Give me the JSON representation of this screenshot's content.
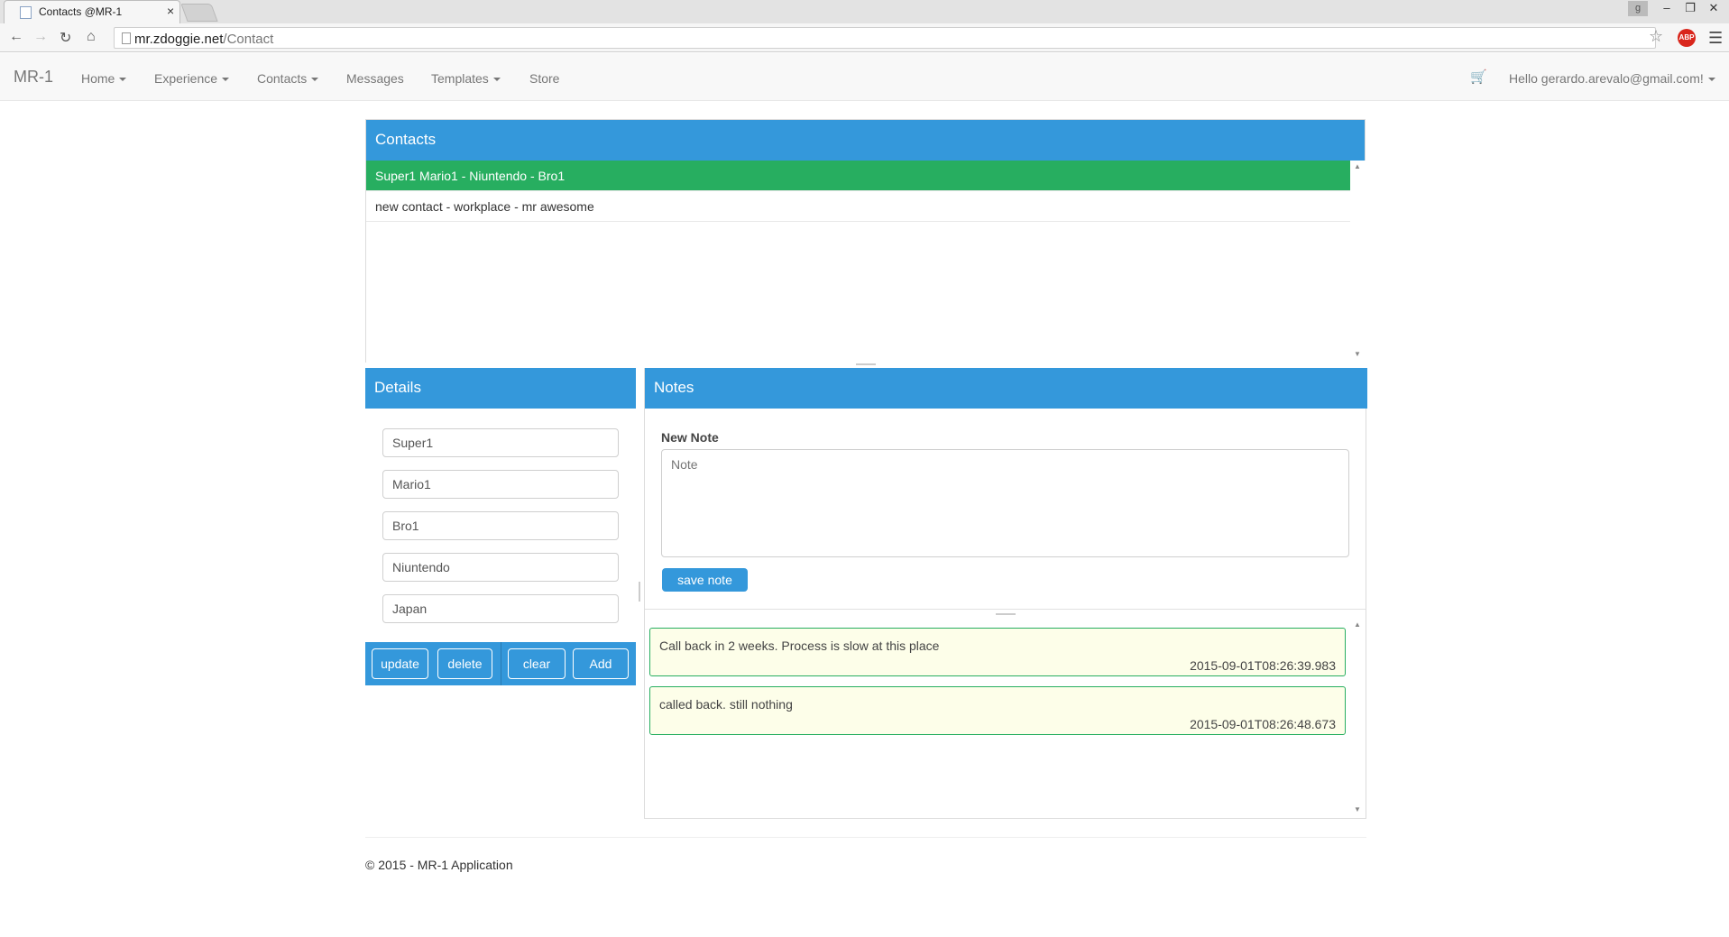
{
  "browser": {
    "tab_title": "Contacts @MR-1",
    "tab_close": "×",
    "url_host": "mr.zdoggie.net",
    "url_path": "/Contact",
    "abp_label": "ABP",
    "window_user": "g",
    "window_buttons": {
      "minimize": "–",
      "restore": "❐",
      "close": "✕"
    },
    "icons": [
      "back-icon",
      "forward-icon",
      "reload-icon",
      "home-icon",
      "star-icon",
      "menu-icon"
    ]
  },
  "navbar": {
    "brand": "MR-1",
    "links": [
      {
        "label": "Home",
        "dropdown": true
      },
      {
        "label": "Experience",
        "dropdown": true
      },
      {
        "label": "Contacts",
        "dropdown": true
      },
      {
        "label": "Messages",
        "dropdown": false
      },
      {
        "label": "Templates",
        "dropdown": true
      },
      {
        "label": "Store",
        "dropdown": false
      }
    ],
    "user_greeting": "Hello gerardo.arevalo@gmail.com!"
  },
  "contacts": {
    "title": "Contacts",
    "items": [
      {
        "label": "Super1 Mario1 - Niuntendo - Bro1",
        "selected": true
      },
      {
        "label": "new contact - workplace - mr awesome",
        "selected": false
      }
    ]
  },
  "details": {
    "title": "Details",
    "fields": [
      "Super1",
      "Mario1",
      "Bro1",
      "Niuntendo",
      "Japan"
    ],
    "buttons": {
      "update": "update",
      "delete": "delete",
      "clear": "clear",
      "add": "Add"
    }
  },
  "notes": {
    "title": "Notes",
    "new_note_label": "New Note",
    "placeholder": "Note",
    "save_label": "save note",
    "items": [
      {
        "text": "Call back in 2 weeks. Process is slow at this place",
        "time": "2015-09-01T08:26:39.983"
      },
      {
        "text": "called back. still nothing",
        "time": "2015-09-01T08:26:48.673"
      }
    ]
  },
  "footer": {
    "text": "© 2015 - MR-1 Application"
  },
  "colors": {
    "primary": "#3498db",
    "selected": "#27ae60",
    "note_bg": "#fdfee9"
  }
}
